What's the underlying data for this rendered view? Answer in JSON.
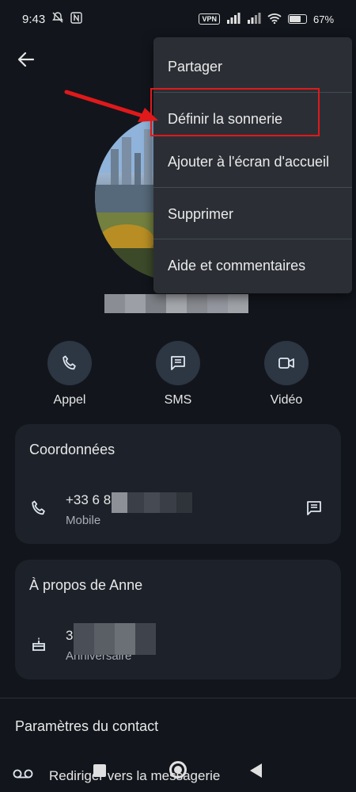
{
  "status_bar": {
    "time": "9:43",
    "vpn": "VPN",
    "battery": "67"
  },
  "contact": {
    "name": "Anne Bonrd"
  },
  "actions": {
    "call": "Appel",
    "sms": "SMS",
    "video": "Vidéo"
  },
  "coordinates_card": {
    "title": "Coordonnées",
    "phone_visible": "+33 6 8",
    "phone_type": "Mobile"
  },
  "about_card": {
    "title": "À propos de Anne",
    "birthday_visible": "3",
    "birthday_label": "Anniversaire"
  },
  "settings": {
    "title": "Paramètres du contact",
    "voicemail": "Rediriger vers la messagerie"
  },
  "menu": {
    "items": [
      {
        "label": "Partager"
      },
      {
        "label": "Définir la sonnerie"
      },
      {
        "label": "Ajouter à l'écran d'accueil"
      },
      {
        "label": "Supprimer"
      },
      {
        "label": "Aide et commentaires"
      }
    ]
  },
  "annotation": {
    "color": "#e0191b"
  }
}
